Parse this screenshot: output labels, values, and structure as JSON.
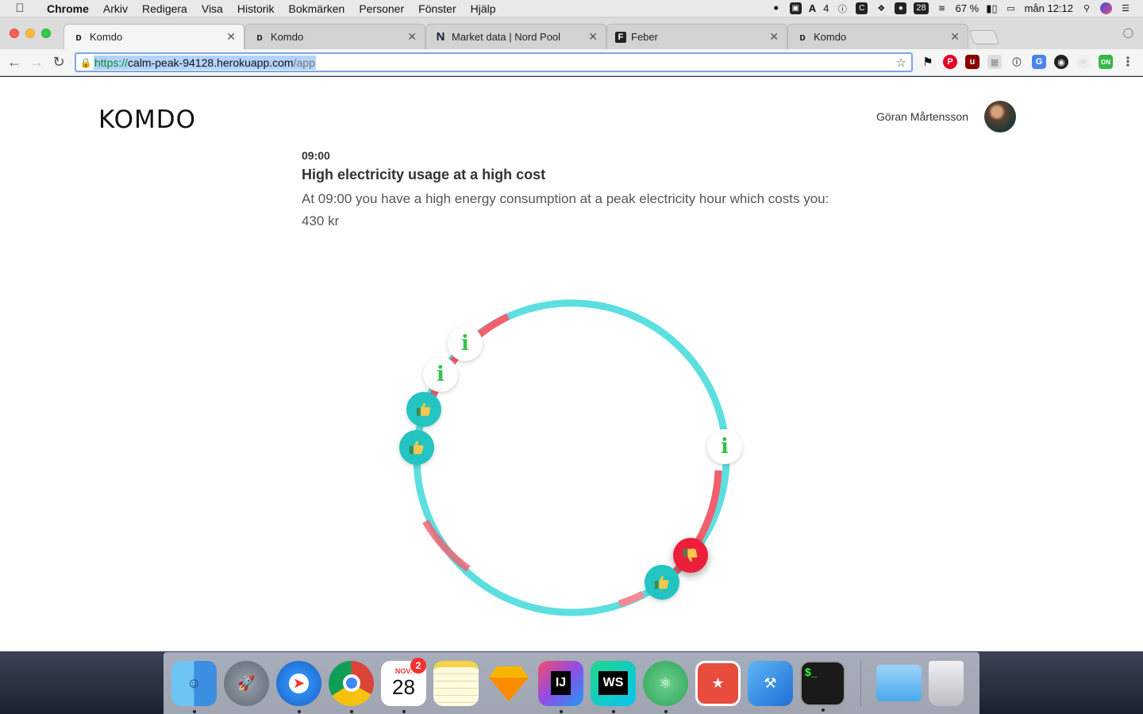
{
  "menubar": {
    "app_name": "Chrome",
    "menus": [
      "Arkiv",
      "Redigera",
      "Visa",
      "Historik",
      "Bokmärken",
      "Personer",
      "Fönster",
      "Hjälp"
    ],
    "status": {
      "adobe_count": "4",
      "calendar_day": "28",
      "battery": "67 %",
      "clock": "mån 12:12"
    }
  },
  "tabs": [
    {
      "title": "Komdo",
      "favicon": "komdo-d-icon",
      "active": true
    },
    {
      "title": "Komdo",
      "favicon": "komdo-d-icon",
      "active": false
    },
    {
      "title": "Market data | Nord Pool",
      "favicon": "nordpool-n-icon",
      "active": false
    },
    {
      "title": "Feber",
      "favicon": "feber-f-icon",
      "active": false
    },
    {
      "title": "Komdo",
      "favicon": "komdo-d-icon",
      "active": false
    }
  ],
  "address": {
    "scheme": "https://",
    "host": "calm-peak-94128.herokuapp.com",
    "path": "/app"
  },
  "app": {
    "logo": "KOMDO",
    "user_name": "Göran Mårtensson",
    "notification": {
      "time": "09:00",
      "title": "High electricity usage at a high cost",
      "body": "At 09:00 you have a high energy consumption at a peak electricity hour which costs you: 430 kr"
    },
    "ring_markers": [
      {
        "type": "info",
        "icon": "info-icon"
      },
      {
        "type": "info",
        "icon": "info-icon"
      },
      {
        "type": "good",
        "icon": "thumbs-up-icon"
      },
      {
        "type": "good",
        "icon": "thumbs-up-icon"
      },
      {
        "type": "info",
        "icon": "info-icon"
      },
      {
        "type": "bad",
        "icon": "thumbs-down-icon"
      },
      {
        "type": "good",
        "icon": "thumbs-up-icon"
      }
    ],
    "colors": {
      "low_cost": "#5ddfe0",
      "high_cost": "#f25f6e",
      "good": "#23c4c1",
      "bad": "#ec1f3a",
      "info": "#35c24c"
    }
  },
  "dock": {
    "calendar_month": "NOV.",
    "calendar_day": "28",
    "calendar_badge": "2",
    "apps": [
      "Finder",
      "Launchpad",
      "Safari",
      "Chrome",
      "Calendar",
      "Notes",
      "Sketch",
      "IntelliJ IDEA",
      "WebStorm",
      "Atom",
      "Wunderlist",
      "Xcode",
      "Terminal",
      "Folder",
      "Trash"
    ]
  }
}
